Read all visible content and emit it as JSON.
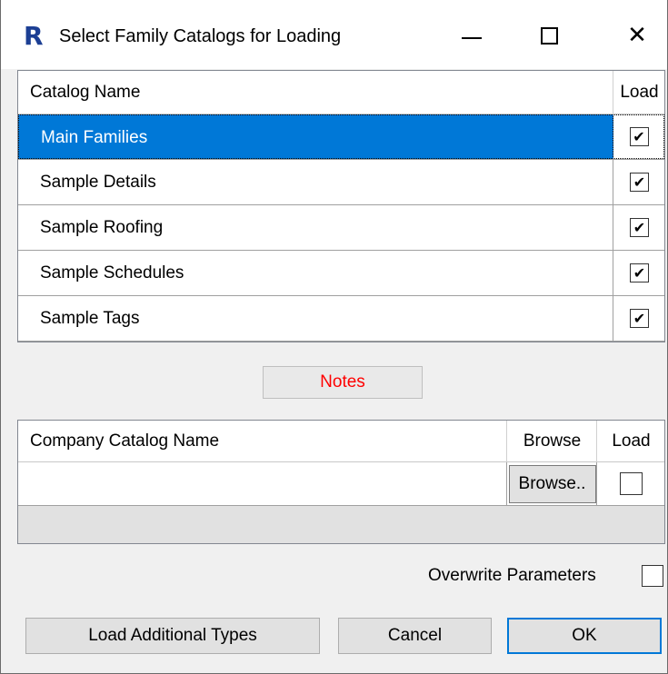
{
  "window": {
    "title": "Select Family Catalogs for Loading",
    "app_icon_letter": "R",
    "controls": {
      "minimize_icon": "minimize-icon",
      "maximize_icon": "maximize-icon",
      "close_icon": "close-icon"
    }
  },
  "catalog_grid": {
    "headers": {
      "name": "Catalog Name",
      "load": "Load"
    },
    "rows": [
      {
        "name": "Main Families",
        "load": true,
        "selected": true
      },
      {
        "name": "Sample Details",
        "load": true,
        "selected": false
      },
      {
        "name": "Sample Roofing",
        "load": true,
        "selected": false
      },
      {
        "name": "Sample Schedules",
        "load": true,
        "selected": false
      },
      {
        "name": "Sample Tags",
        "load": true,
        "selected": false
      }
    ]
  },
  "notes_button": {
    "label": "Notes",
    "color": "#ff0000"
  },
  "company_grid": {
    "headers": {
      "name": "Company Catalog Name",
      "browse": "Browse",
      "load": "Load"
    },
    "rows": [
      {
        "name": "",
        "browse_label": "Browse..",
        "load": false
      }
    ]
  },
  "overwrite": {
    "label": "Overwrite Parameters",
    "checked": false
  },
  "buttons": {
    "load_additional": "Load Additional Types",
    "cancel": "Cancel",
    "ok": "OK"
  },
  "colors": {
    "selection": "#0078d7",
    "accent": "#0078d7"
  },
  "checkmark_glyph": "✔"
}
